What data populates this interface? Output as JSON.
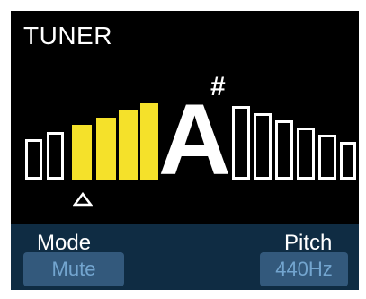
{
  "tuner": {
    "title": "TUNER",
    "note": "A",
    "accidental": "#",
    "lit_segments": [
      2,
      3,
      4,
      5
    ],
    "segment_count": 14,
    "accent_color": "#f5e12a",
    "pointer_icon": "triangle-up-icon"
  },
  "controls": {
    "mode_label": "Mode",
    "mode_value": "Mute",
    "pitch_label": "Pitch",
    "pitch_value": "440Hz"
  }
}
